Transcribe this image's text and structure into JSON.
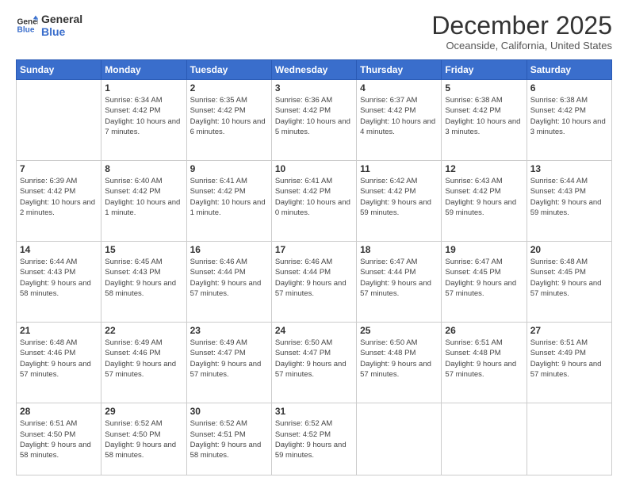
{
  "logo": {
    "line1": "General",
    "line2": "Blue"
  },
  "title": "December 2025",
  "location": "Oceanside, California, United States",
  "weekdays": [
    "Sunday",
    "Monday",
    "Tuesday",
    "Wednesday",
    "Thursday",
    "Friday",
    "Saturday"
  ],
  "weeks": [
    [
      {
        "day": "",
        "empty": true
      },
      {
        "day": "1",
        "sunrise": "6:34 AM",
        "sunset": "4:42 PM",
        "daylight": "10 hours and 7 minutes."
      },
      {
        "day": "2",
        "sunrise": "6:35 AM",
        "sunset": "4:42 PM",
        "daylight": "10 hours and 6 minutes."
      },
      {
        "day": "3",
        "sunrise": "6:36 AM",
        "sunset": "4:42 PM",
        "daylight": "10 hours and 5 minutes."
      },
      {
        "day": "4",
        "sunrise": "6:37 AM",
        "sunset": "4:42 PM",
        "daylight": "10 hours and 4 minutes."
      },
      {
        "day": "5",
        "sunrise": "6:38 AM",
        "sunset": "4:42 PM",
        "daylight": "10 hours and 3 minutes."
      },
      {
        "day": "6",
        "sunrise": "6:38 AM",
        "sunset": "4:42 PM",
        "daylight": "10 hours and 3 minutes."
      }
    ],
    [
      {
        "day": "7",
        "sunrise": "6:39 AM",
        "sunset": "4:42 PM",
        "daylight": "10 hours and 2 minutes."
      },
      {
        "day": "8",
        "sunrise": "6:40 AM",
        "sunset": "4:42 PM",
        "daylight": "10 hours and 1 minute."
      },
      {
        "day": "9",
        "sunrise": "6:41 AM",
        "sunset": "4:42 PM",
        "daylight": "10 hours and 1 minute."
      },
      {
        "day": "10",
        "sunrise": "6:41 AM",
        "sunset": "4:42 PM",
        "daylight": "10 hours and 0 minutes."
      },
      {
        "day": "11",
        "sunrise": "6:42 AM",
        "sunset": "4:42 PM",
        "daylight": "9 hours and 59 minutes."
      },
      {
        "day": "12",
        "sunrise": "6:43 AM",
        "sunset": "4:42 PM",
        "daylight": "9 hours and 59 minutes."
      },
      {
        "day": "13",
        "sunrise": "6:44 AM",
        "sunset": "4:43 PM",
        "daylight": "9 hours and 59 minutes."
      }
    ],
    [
      {
        "day": "14",
        "sunrise": "6:44 AM",
        "sunset": "4:43 PM",
        "daylight": "9 hours and 58 minutes."
      },
      {
        "day": "15",
        "sunrise": "6:45 AM",
        "sunset": "4:43 PM",
        "daylight": "9 hours and 58 minutes."
      },
      {
        "day": "16",
        "sunrise": "6:46 AM",
        "sunset": "4:44 PM",
        "daylight": "9 hours and 57 minutes."
      },
      {
        "day": "17",
        "sunrise": "6:46 AM",
        "sunset": "4:44 PM",
        "daylight": "9 hours and 57 minutes."
      },
      {
        "day": "18",
        "sunrise": "6:47 AM",
        "sunset": "4:44 PM",
        "daylight": "9 hours and 57 minutes."
      },
      {
        "day": "19",
        "sunrise": "6:47 AM",
        "sunset": "4:45 PM",
        "daylight": "9 hours and 57 minutes."
      },
      {
        "day": "20",
        "sunrise": "6:48 AM",
        "sunset": "4:45 PM",
        "daylight": "9 hours and 57 minutes."
      }
    ],
    [
      {
        "day": "21",
        "sunrise": "6:48 AM",
        "sunset": "4:46 PM",
        "daylight": "9 hours and 57 minutes."
      },
      {
        "day": "22",
        "sunrise": "6:49 AM",
        "sunset": "4:46 PM",
        "daylight": "9 hours and 57 minutes."
      },
      {
        "day": "23",
        "sunrise": "6:49 AM",
        "sunset": "4:47 PM",
        "daylight": "9 hours and 57 minutes."
      },
      {
        "day": "24",
        "sunrise": "6:50 AM",
        "sunset": "4:47 PM",
        "daylight": "9 hours and 57 minutes."
      },
      {
        "day": "25",
        "sunrise": "6:50 AM",
        "sunset": "4:48 PM",
        "daylight": "9 hours and 57 minutes."
      },
      {
        "day": "26",
        "sunrise": "6:51 AM",
        "sunset": "4:48 PM",
        "daylight": "9 hours and 57 minutes."
      },
      {
        "day": "27",
        "sunrise": "6:51 AM",
        "sunset": "4:49 PM",
        "daylight": "9 hours and 57 minutes."
      }
    ],
    [
      {
        "day": "28",
        "sunrise": "6:51 AM",
        "sunset": "4:50 PM",
        "daylight": "9 hours and 58 minutes."
      },
      {
        "day": "29",
        "sunrise": "6:52 AM",
        "sunset": "4:50 PM",
        "daylight": "9 hours and 58 minutes."
      },
      {
        "day": "30",
        "sunrise": "6:52 AM",
        "sunset": "4:51 PM",
        "daylight": "9 hours and 58 minutes."
      },
      {
        "day": "31",
        "sunrise": "6:52 AM",
        "sunset": "4:52 PM",
        "daylight": "9 hours and 59 minutes."
      },
      {
        "day": "",
        "empty": true
      },
      {
        "day": "",
        "empty": true
      },
      {
        "day": "",
        "empty": true
      }
    ]
  ],
  "labels": {
    "sunrise": "Sunrise:",
    "sunset": "Sunset:",
    "daylight": "Daylight:"
  }
}
